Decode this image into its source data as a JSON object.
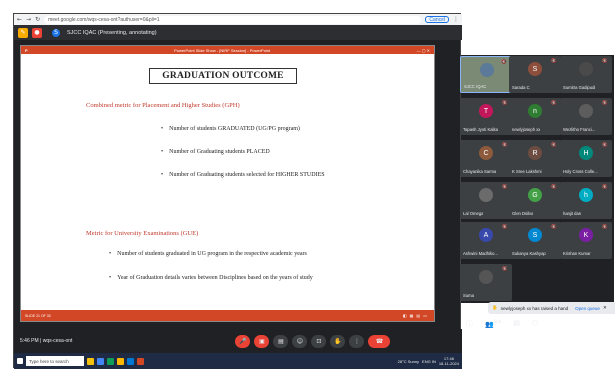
{
  "browser": {
    "url": "meet.google.com/wqs-cesa-ont?authuser=0&pli=1",
    "cancel_label": "Cancel"
  },
  "meet": {
    "presenting_label": "SJCC IQAC (Presenting, annotating)",
    "time": "5:46 PM",
    "code": "wqs-cesa-ont",
    "raised_hand_text": "newlyjoseph xx has raised a hand",
    "open_queue": "Open queue",
    "participant_count": "104"
  },
  "ppt": {
    "window_title": "PowerPoint Slide Show - [NIRF Session] - PowerPoint",
    "slide_counter": "SLIDE 21 OF 30"
  },
  "slide": {
    "title": "GRADUATION OUTCOME",
    "section1": "Combined metric for Placement and Higher Studies (GPH)",
    "bullets1": [
      "Number of students GRADUATED (UG/PG program)",
      "Number of Graduating students PLACED",
      "Number of Graduating students selected for HIGHER STUDIES"
    ],
    "section2": "Metric for University Examinations (GUE)",
    "bullets2": [
      "Number of students graduated in UG program in the respective academic years",
      "Year of Graduation details varies between Disciplines based on the years of study"
    ]
  },
  "participants": [
    {
      "name": "SJCC IQAC",
      "initial": "",
      "color": "#5b7a9a"
    },
    {
      "name": "Sarada C",
      "initial": "S",
      "color": "#8d4e3c"
    },
    {
      "name": "Sumitra Gadipudi",
      "initial": "",
      "color": "#4a4a4a"
    },
    {
      "name": "Tapash Jyoti Kalita",
      "initial": "T",
      "color": "#c2185b"
    },
    {
      "name": "newlyjoseph xx",
      "initial": "n",
      "color": "#2e7d32"
    },
    {
      "name": "Wezlitho Franci...",
      "initial": "",
      "color": "#5d5d5d"
    },
    {
      "name": "Chayanika Sarma",
      "initial": "C",
      "color": "#8d5a3c"
    },
    {
      "name": "K Sree Lakshmi",
      "initial": "R",
      "color": "#6d4c41"
    },
    {
      "name": "Holy Cross Colle...",
      "initial": "H",
      "color": "#00897b"
    },
    {
      "name": "Lal Omega",
      "initial": "",
      "color": "#6b6b6b"
    },
    {
      "name": "Glen Dsilva",
      "initial": "G",
      "color": "#43a047"
    },
    {
      "name": "hanjit das",
      "initial": "h",
      "color": "#00acc1"
    },
    {
      "name": "Ashwini Madhiko...",
      "initial": "A",
      "color": "#3949ab"
    },
    {
      "name": "Sukanya Kashyap",
      "initial": "S",
      "color": "#0288d1"
    },
    {
      "name": "Krishan Kumar",
      "initial": "K",
      "color": "#7b1fa2"
    },
    {
      "name": "Suma",
      "initial": "",
      "color": "#555"
    }
  ],
  "taskbar": {
    "search_placeholder": "Type here to search",
    "weather": "28°C Sunny",
    "lang": "ENG IN",
    "clock_time": "17:46",
    "clock_date": "18-11-2024"
  },
  "colors": {
    "ppt_accent": "#d24726",
    "end_call": "#ea4335",
    "section_red": "#c0392b"
  }
}
